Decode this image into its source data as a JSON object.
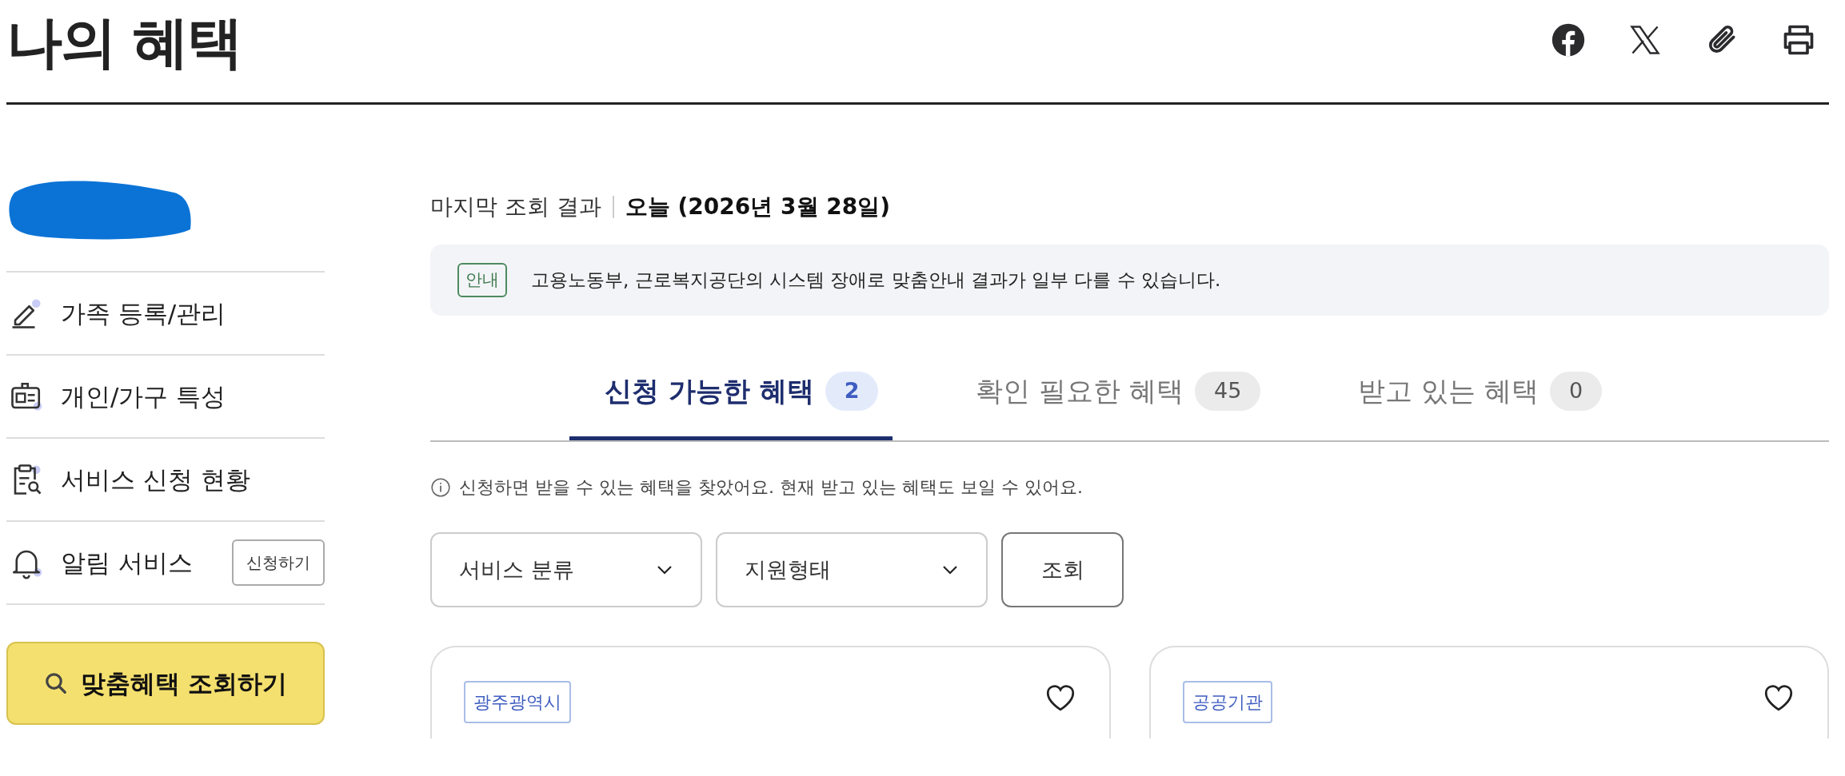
{
  "page": {
    "title": "나의 혜택"
  },
  "sidebar": {
    "items": [
      {
        "label": "가족 등록/관리"
      },
      {
        "label": "개인/가구 특성"
      },
      {
        "label": "서비스 신청 현황"
      },
      {
        "label": "알림 서비스",
        "action": "신청하기"
      }
    ],
    "search_button": "맞춤혜택 조회하기"
  },
  "last_result": {
    "label": "마지막 조회 결과",
    "value": "오늘 (2026년 3월 28일)"
  },
  "notice": {
    "badge": "안내",
    "text": "고용노동부, 근로복지공단의 시스템 장애로 맞춤안내 결과가 일부 다를 수 있습니다."
  },
  "tabs": [
    {
      "label": "신청 가능한 혜택",
      "count": "2",
      "selected": true
    },
    {
      "label": "확인 필요한 혜택",
      "count": "45",
      "selected": false
    },
    {
      "label": "받고 있는 혜택",
      "count": "0",
      "selected": false
    }
  ],
  "hint": "신청하면 받을 수 있는 혜택을 찾았어요. 현재 받고 있는 혜택도 보일 수 있어요.",
  "filters": [
    {
      "label": "서비스 분류"
    },
    {
      "label": "지원형태"
    }
  ],
  "filter_button": "조회",
  "cards": [
    {
      "tag": "광주광역시",
      "favorite": false
    },
    {
      "tag": "공공기관",
      "favorite": false
    }
  ]
}
